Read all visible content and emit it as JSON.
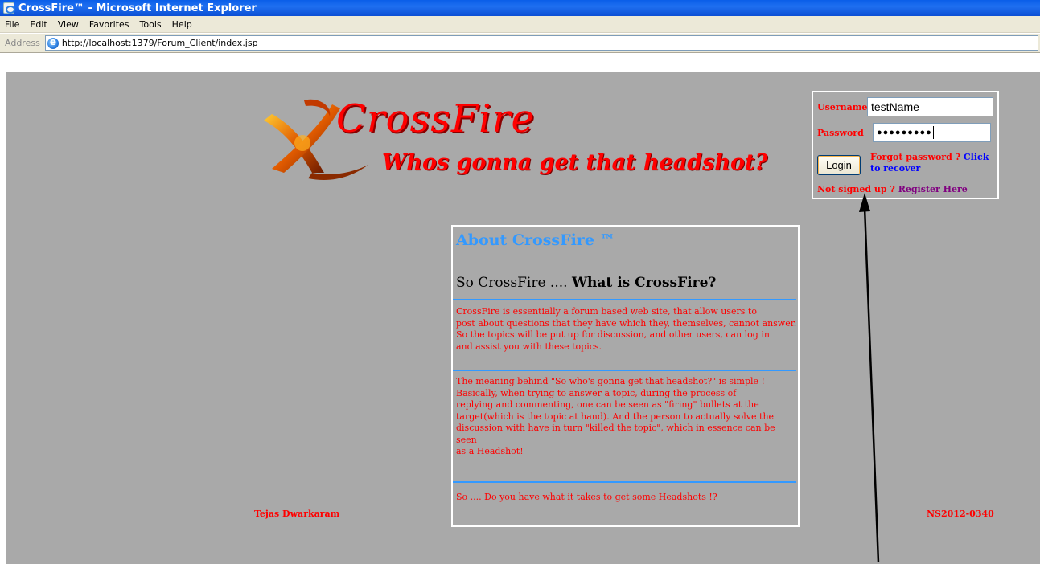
{
  "window": {
    "title": "CrossFire™ - Microsoft Internet Explorer"
  },
  "menu": {
    "items": [
      "File",
      "Edit",
      "View",
      "Favorites",
      "Tools",
      "Help"
    ]
  },
  "address": {
    "label": "Address",
    "url": "http://localhost:1379/Forum_Client/index.jsp"
  },
  "brand": {
    "title": "CrossFire",
    "tagline": "Whos gonna get that headshot?"
  },
  "login": {
    "username_label": "Username",
    "username_value": "testName",
    "password_label": "Password",
    "password_dots": "●●●●●●●●●",
    "login_button": "Login",
    "forgot_text": "Forgot password ?",
    "forgot_link": "Click to recover",
    "signup_text": "Not signed up ?",
    "register_link": "Register Here"
  },
  "about": {
    "title": "About CrossFire ™",
    "subtitle_prefix": "So CrossFire ....",
    "subtitle_link": "What is CrossFire?",
    "para1_l1": "CrossFire is essentially a forum based web site, that allow users to",
    "para1_l2": "post about questions that they have which they, themselves, cannot answer.",
    "para1_l3": "So the topics will be put up for discussion, and other users, can log in",
    "para1_l4": "and assist you with these topics.",
    "para2_l1": "The meaning behind \"So who's gonna get that headshot?\" is simple !",
    "para2_l2": "Basically, when trying to answer a topic, during the process of",
    "para2_l3": "replying and commenting, one can be seen as \"firing\" bullets at the",
    "para2_l4": "target(which is the topic at hand). And the person to actually solve the",
    "para2_l5": "discussion with have in turn \"killed the topic\", which in essence can be seen",
    "para2_l6": "as a Headshot!",
    "para3": "So .... Do you have what it takes to get some Headshots !?"
  },
  "footer": {
    "left": "Tejas Dwarkaram",
    "right": "NS2012-0340"
  },
  "colors": {
    "page_bg": "#a9a9a9",
    "accent_red": "#ff0000",
    "accent_blue": "#3399ff"
  }
}
